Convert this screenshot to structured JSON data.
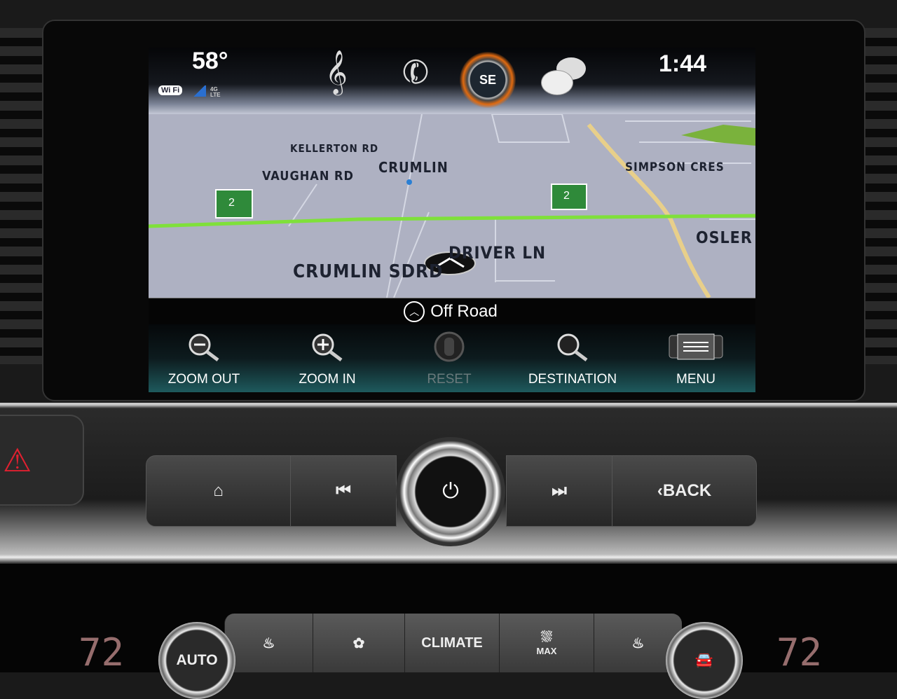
{
  "status_bar": {
    "temperature": "58°",
    "wifi_label": "Wi Fi",
    "network": "4G LTE",
    "time": "1:44",
    "compass_heading": "SE",
    "icons": [
      "music-note-icon",
      "phone-icon",
      "compass-icon",
      "messages-icon"
    ],
    "accent_color": "#e06a10"
  },
  "map": {
    "labels": [
      "KELLERTON RD",
      "VAUGHAN RD",
      "CRUMLIN",
      "SIMPSON CRES",
      "OSLER",
      "DRIVER LN",
      "CRUMLIN SDRD"
    ],
    "highway_shield": "2",
    "highway_color": "#7fe03a",
    "road_color": "#e8cf8a"
  },
  "guidance": {
    "text": "Off Road"
  },
  "toolbar": [
    {
      "label": "ZOOM OUT",
      "icon": "zoom-out-icon"
    },
    {
      "label": "ZOOM IN",
      "icon": "zoom-in-icon"
    },
    {
      "label": "RESET",
      "icon": "reset-icon"
    },
    {
      "label": "DESTINATION",
      "icon": "search-icon"
    },
    {
      "label": "MENU",
      "icon": "menu-icon"
    }
  ],
  "hardware": {
    "back_label": "BACK",
    "buttons": [
      "home-icon",
      "previous-track-icon",
      "power-icon",
      "next-track-icon",
      "back-icon"
    ]
  },
  "climate": {
    "left_temp": "72",
    "right_temp": "72",
    "auto_label": "AUTO",
    "climate_label": "CLIMATE",
    "max_label": "MAX"
  }
}
